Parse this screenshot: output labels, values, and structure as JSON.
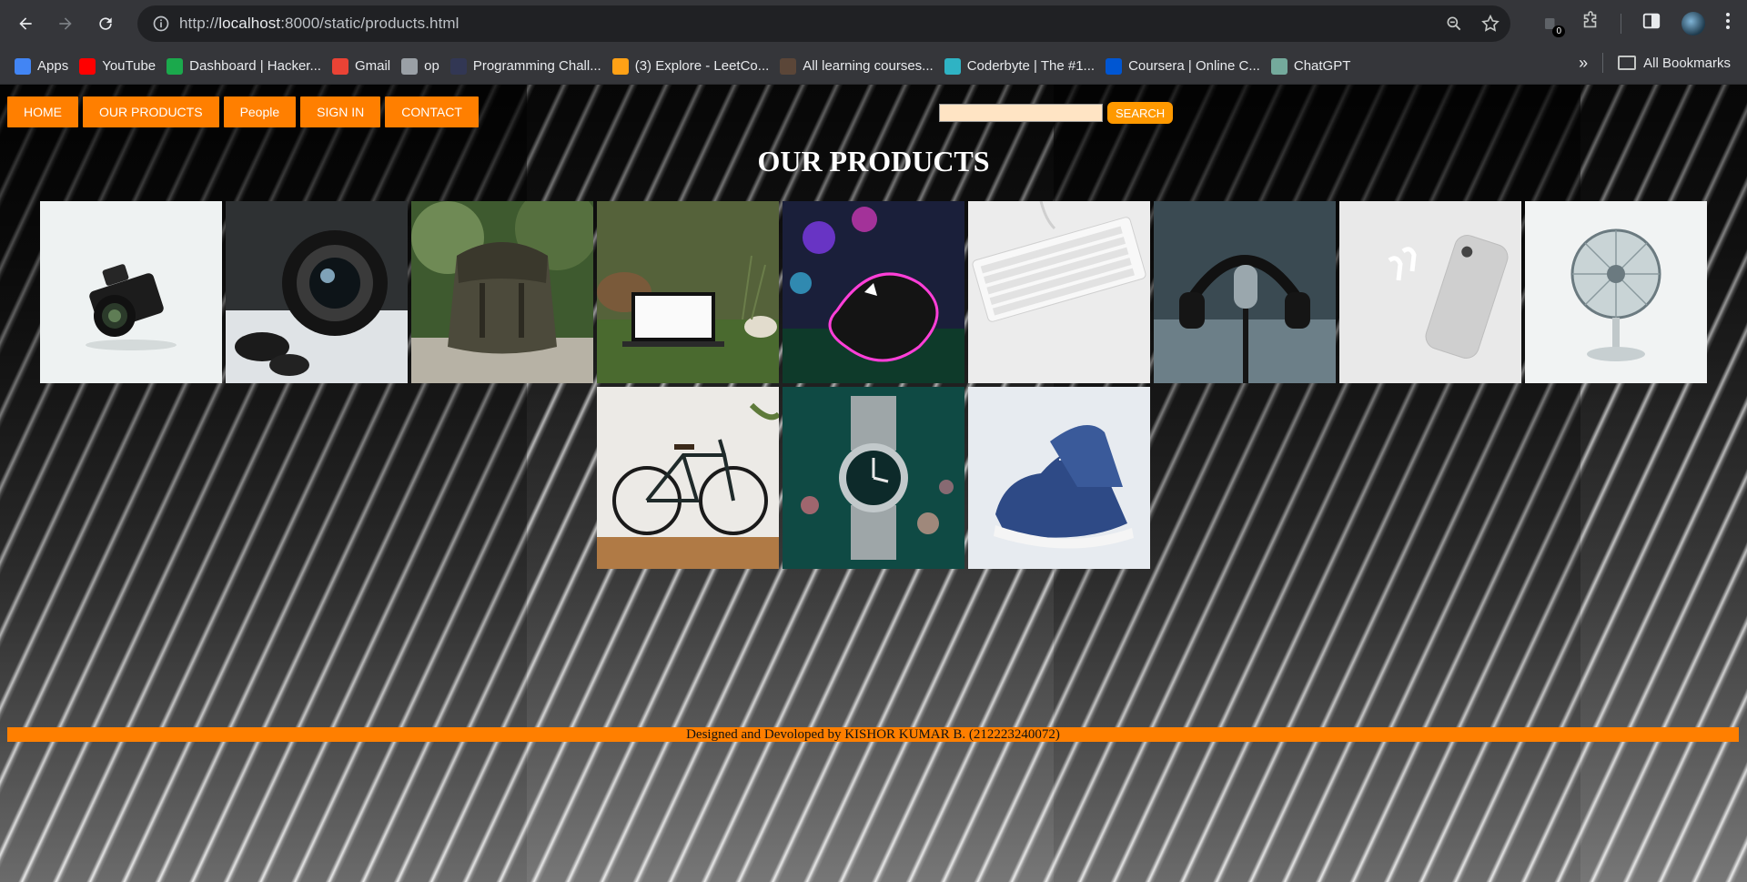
{
  "browser": {
    "url_scheme": "http://",
    "url_host": "localhost",
    "url_path": ":8000/static/products.html",
    "extension_badge": "0",
    "bookmarks": [
      {
        "label": "Apps",
        "icon": "apps-grid-icon",
        "color": "#4285f4"
      },
      {
        "label": "YouTube",
        "icon": "youtube-icon",
        "color": "#ff0000"
      },
      {
        "label": "Dashboard | Hacker...",
        "icon": "hackerrank-icon",
        "color": "#1ba94c"
      },
      {
        "label": "Gmail",
        "icon": "gmail-icon",
        "color": "#ea4335"
      },
      {
        "label": "op",
        "icon": "globe-icon",
        "color": "#9aa0a6"
      },
      {
        "label": "Programming Chall...",
        "icon": "hackerearth-icon",
        "color": "#323754"
      },
      {
        "label": "(3) Explore - LeetCo...",
        "icon": "leetcode-icon",
        "color": "#ffa116"
      },
      {
        "label": "All learning courses...",
        "icon": "codechef-icon",
        "color": "#5b4638"
      },
      {
        "label": "Coderbyte | The #1...",
        "icon": "coderbyte-icon",
        "color": "#2fb3c4"
      },
      {
        "label": "Coursera | Online C...",
        "icon": "coursera-icon",
        "color": "#0056d2"
      },
      {
        "label": "ChatGPT",
        "icon": "chatgpt-icon",
        "color": "#74aa9c"
      }
    ],
    "all_bookmarks_label": "All Bookmarks"
  },
  "site": {
    "nav": [
      "HOME",
      "OUR PRODUCTS",
      "People",
      "SIGN IN",
      "CONTACT"
    ],
    "search_value": "",
    "search_button": "SEARCH",
    "title": "OUR PRODUCTS",
    "products": [
      {
        "name": "camera-image"
      },
      {
        "name": "camera-lens-image"
      },
      {
        "name": "backpack-image"
      },
      {
        "name": "laptop-image"
      },
      {
        "name": "gaming-mouse-image"
      },
      {
        "name": "keyboard-image"
      },
      {
        "name": "headphones-microphone-image"
      },
      {
        "name": "iphone-airpods-image"
      },
      {
        "name": "desk-fan-image"
      },
      {
        "name": "bicycle-image"
      },
      {
        "name": "wristwatch-image"
      },
      {
        "name": "sneakers-image"
      }
    ],
    "footer": "Designed and Devoloped by KISHOR KUMAR B. (212223240072)",
    "accent_color": "#ff7f00"
  }
}
